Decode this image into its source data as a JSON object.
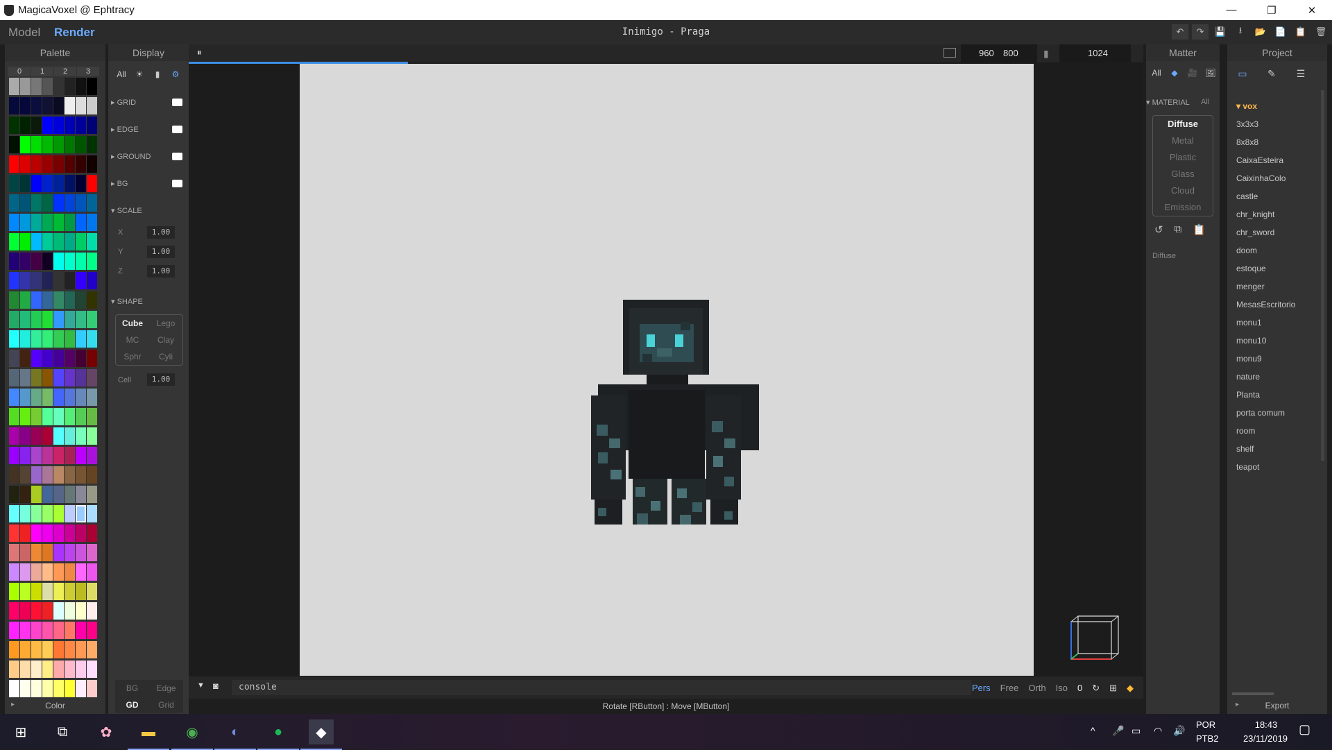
{
  "window": {
    "title": "MagicaVoxel @ Ephtracy",
    "minimize": "—",
    "restore": "❐",
    "close": "✕"
  },
  "menubar": {
    "model": "Model",
    "render": "Render",
    "file_title": "Inimigo - Praga",
    "tools": [
      "↶",
      "↷",
      "💾",
      "⭳",
      "📂",
      "📄",
      "📋",
      "🗑"
    ]
  },
  "palette": {
    "title": "Palette",
    "tabs": [
      "0",
      "1",
      "2",
      "3"
    ],
    "footer_label": "Color",
    "footer_arrow": "▸",
    "colors": [
      "#aaaaaa",
      "#999999",
      "#777777",
      "#555555",
      "#333333",
      "#222222",
      "#111111",
      "#000000",
      "#050a3a",
      "#06083a",
      "#0b0d3d",
      "#111133",
      "#0a0a22",
      "#eeeeee",
      "#dddddd",
      "#cccccc",
      "#003300",
      "#002200",
      "#0b1a0b",
      "#0000ff",
      "#0000dd",
      "#0000bb",
      "#000099",
      "#000077",
      "#001100",
      "#00ff00",
      "#00dd00",
      "#00bb00",
      "#009900",
      "#007700",
      "#005500",
      "#003300",
      "#ff0000",
      "#dd0000",
      "#bb0000",
      "#990000",
      "#770000",
      "#550000",
      "#330000",
      "#110000",
      "#004444",
      "#003333",
      "#0000ff",
      "#0022cc",
      "#002299",
      "#001166",
      "#000033",
      "#ff0000",
      "#006688",
      "#005577",
      "#007766",
      "#006644",
      "#0033ff",
      "#0044dd",
      "#0055bb",
      "#006699",
      "#0088ff",
      "#0099dd",
      "#00aa99",
      "#00aa55",
      "#00bb33",
      "#009944",
      "#0066ff",
      "#0077ee",
      "#00ff33",
      "#00ee00",
      "#00bbff",
      "#00cc99",
      "#00bb77",
      "#00aa88",
      "#00cc66",
      "#00ddaa",
      "#220077",
      "#330066",
      "#440044",
      "#110022",
      "#00ffee",
      "#00ffcc",
      "#00ffaa",
      "#00ff88",
      "#2233ff",
      "#3333aa",
      "#333377",
      "#222255",
      "#333333",
      "#222222",
      "#3300ff",
      "#2200cc",
      "#228833",
      "#22aa44",
      "#3366ff",
      "#336699",
      "#338866",
      "#226655",
      "#224433",
      "#333300",
      "#22aa66",
      "#22bb77",
      "#22cc55",
      "#22dd33",
      "#3399ff",
      "#33aa99",
      "#33bb88",
      "#33cc77",
      "#22ffff",
      "#22eedd",
      "#33ee99",
      "#33ee77",
      "#33cc55",
      "#33bb44",
      "#33ccff",
      "#33ddee",
      "#444455",
      "#442211",
      "#5500ff",
      "#4400cc",
      "#440099",
      "#550066",
      "#440033",
      "#770000",
      "#556677",
      "#667788",
      "#777722",
      "#885500",
      "#5544ff",
      "#6633cc",
      "#553399",
      "#664466",
      "#4488ff",
      "#5599cc",
      "#66aa88",
      "#77bb66",
      "#4466ff",
      "#5577dd",
      "#6688bb",
      "#7799aa",
      "#55dd22",
      "#66ee11",
      "#77cc33",
      "#55ff99",
      "#66ffbb",
      "#55ee77",
      "#55cc55",
      "#66bb44",
      "#aa00aa",
      "#880088",
      "#990055",
      "#aa0033",
      "#55ffff",
      "#66eedd",
      "#77ffbb",
      "#88ff99",
      "#9900ff",
      "#8822ee",
      "#aa44cc",
      "#bb3399",
      "#cc2266",
      "#aa2255",
      "#bb00ff",
      "#aa11dd",
      "#443322",
      "#554433",
      "#9966cc",
      "#aa7799",
      "#bb8866",
      "#886644",
      "#775533",
      "#664422",
      "#222211",
      "#332211",
      "#aacc22",
      "#446699",
      "#556688",
      "#667777",
      "#888899",
      "#999988",
      "#66ffff",
      "#77ffdd",
      "#88ff99",
      "#99ff66",
      "#aaff33",
      "#bbccff",
      "#99ccff",
      "#aaddff",
      "#ff3333",
      "#ee2222",
      "#ff00ff",
      "#ee00ee",
      "#dd00cc",
      "#cc0099",
      "#bb0066",
      "#aa0033",
      "#dd7777",
      "#cc6666",
      "#ee8833",
      "#dd7722",
      "#aa33ff",
      "#bb44ee",
      "#cc55dd",
      "#dd66cc",
      "#cc88ff",
      "#dd99ee",
      "#eeaa99",
      "#ffbb88",
      "#ff9955",
      "#ee8844",
      "#ff66ff",
      "#ee55ee",
      "#aaff00",
      "#bbff22",
      "#ccdd00",
      "#ddddaa",
      "#eeee55",
      "#cccc33",
      "#bbbb22",
      "#dddd66",
      "#ff0066",
      "#ee0055",
      "#ff1133",
      "#ee2222",
      "#ddffff",
      "#eeffdd",
      "#ffffcc",
      "#ffeeee",
      "#ff22ff",
      "#ff33ee",
      "#ff44cc",
      "#ff55aa",
      "#ff6688",
      "#ff7766",
      "#ff00aa",
      "#ff0088",
      "#ff9922",
      "#ffaa33",
      "#ffbb44",
      "#ffcc55",
      "#ff7733",
      "#ff8844",
      "#ff9955",
      "#ffaa66",
      "#ffcc88",
      "#ffddaa",
      "#ffeecc",
      "#ffee88",
      "#ffaaaa",
      "#ffbbcc",
      "#ffccee",
      "#ffddff",
      "#ffffff",
      "#ffffee",
      "#ffffdd",
      "#ffffaa",
      "#ffff66",
      "#ffff33",
      "#ffeeff",
      "#ffcccc"
    ],
    "selected_index": 182
  },
  "display": {
    "title": "Display",
    "tabs": [
      {
        "label": "All",
        "icon": ""
      },
      {
        "label": "",
        "icon": "☀"
      },
      {
        "label": "",
        "icon": "▮"
      },
      {
        "label": "",
        "icon": "⚙"
      }
    ],
    "sections": {
      "grid": "GRID",
      "edge": "EDGE",
      "ground": "GROUND",
      "bg": "BG",
      "scale": "SCALE",
      "shape": "SHAPE"
    },
    "scale": {
      "x_label": "X",
      "x": "1.00",
      "y_label": "Y",
      "y": "1.00",
      "z_label": "Z",
      "z": "1.00"
    },
    "shapes": [
      "Cube",
      "Lego",
      "MC",
      "Clay",
      "Sphr",
      "Cyli"
    ],
    "cell_label": "Cell",
    "cell": "1.00",
    "bottom": {
      "bg": "BG",
      "edge": "Edge",
      "gd": "GD",
      "grid": "Grid"
    }
  },
  "viewport": {
    "resolution_w": "960",
    "resolution_h": "800",
    "samples": "1024",
    "pause_icon": "⏸"
  },
  "console": {
    "value": "console",
    "modes": [
      "Pers",
      "Free",
      "Orth",
      "Iso",
      "0"
    ],
    "status": "Rotate [RButton] : Move [MButton]"
  },
  "matter": {
    "title": "Matter",
    "tabs": [
      "All",
      "◆",
      "🎥",
      "🖼"
    ],
    "material_label": "MATERIAL",
    "material_all": "All",
    "materials": [
      "Diffuse",
      "Metal",
      "Plastic",
      "Glass",
      "Cloud",
      "Emission"
    ],
    "selected": "Diffuse",
    "current": "Diffuse"
  },
  "project": {
    "title": "Project",
    "folder": "vox",
    "files": [
      "3x3x3",
      "8x8x8",
      "CaixaEsteira",
      "CaixinhaColo",
      "castle",
      "chr_knight",
      "chr_sword",
      "doom",
      "estoque",
      "menger",
      "MesasEscritorio",
      "monu1",
      "monu10",
      "monu9",
      "nature",
      "Planta",
      "porta comum",
      "room",
      "shelf",
      "teapot"
    ],
    "export": "Export"
  },
  "taskbar": {
    "lang": "POR",
    "layout": "PTB2",
    "time": "18:43",
    "date": "23/11/2019"
  }
}
